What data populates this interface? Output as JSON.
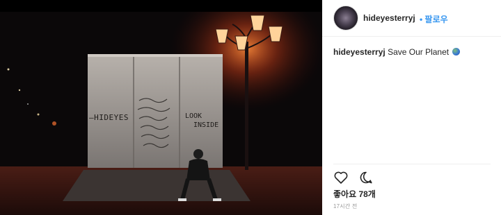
{
  "post": {
    "username": "hideyesterryj",
    "follow_label": "• 팔로우",
    "caption_user": "hideyesterryj",
    "caption_text": "Save Our Planet",
    "caption_emoji": "globe-emoji",
    "likes": "좋아요 78개",
    "timestamp": "17시간 전"
  },
  "photo": {
    "wall_text_left": "—HIDEYES",
    "wall_text_right_1": "LOOK",
    "wall_text_right_2": "INSIDE"
  },
  "icons": {
    "like": "heart-icon",
    "comment": "comment-icon",
    "avatar": "avatar"
  },
  "colors": {
    "link": "#3897f0",
    "text": "#262626",
    "muted": "#999999",
    "lamp_glow": "#ff6a2b"
  }
}
